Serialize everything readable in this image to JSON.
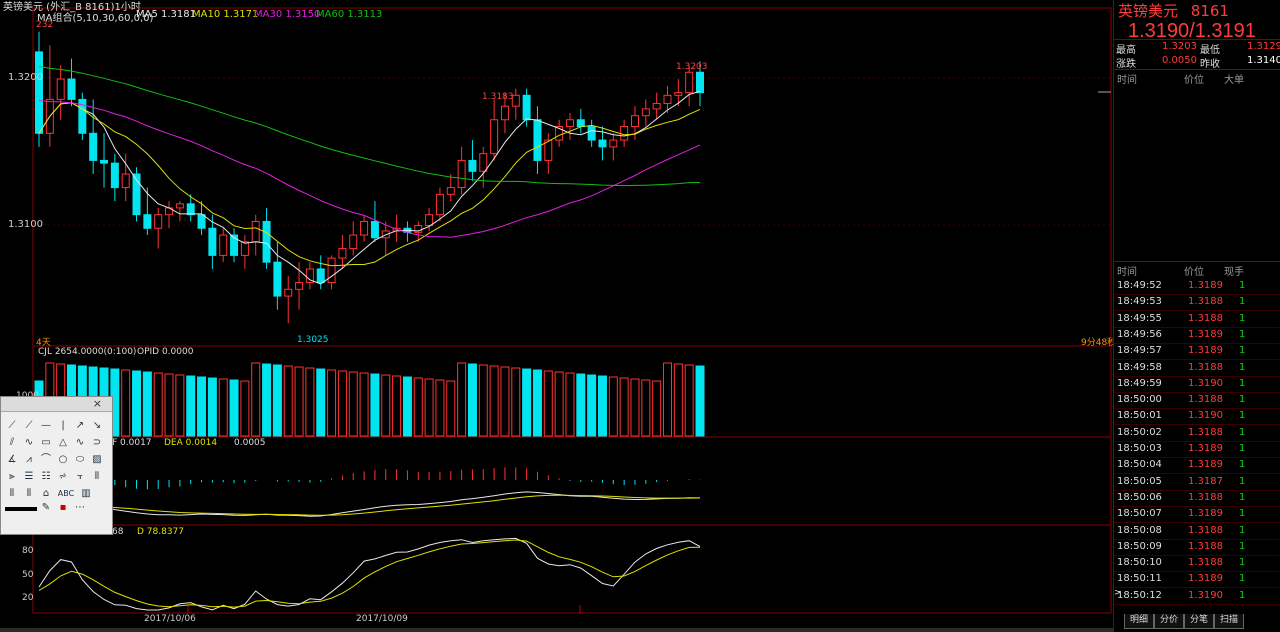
{
  "window": {
    "title": "英镑美元 (外汇_B 8161)1小时",
    "countdown": "9分48秒",
    "period_label": "4天"
  },
  "main_panel": {
    "ma_label": "MA组合(5,10,30,60,0,0)",
    "ma5": "MA5 1.3181",
    "ma10": "MA10 1.3171",
    "ma30": "MA30 1.3150",
    "ma60": "MA60 1.3113",
    "left_top_label": "232",
    "price_ticks": [
      "1.3200",
      "1.3100"
    ],
    "annotations": {
      "high_label": "1.3203",
      "mid_high_label": "1.3183",
      "low_label": "1.3025"
    }
  },
  "volume_panel": {
    "cjl": "CJL  2654.0000(0:100)",
    "opid": "OPID  0.0000",
    "tick": "1000"
  },
  "macd_panel": {
    "dif": "F  0.0017",
    "dea": "DEA  0.0014",
    "macd": "0.0005"
  },
  "kd_panel": {
    "k": "68",
    "d": "D  78.8377",
    "ticks": [
      "80",
      "50",
      "20"
    ]
  },
  "date_axis": [
    "2017/10/06",
    "2017/10/09"
  ],
  "colors": {
    "up": "#ff3232",
    "down": "#00e5f0",
    "ma5": "#e8e8e8",
    "ma10": "#e0e000",
    "ma30": "#e020e0",
    "ma60": "#10c010",
    "grid": "#8a0000"
  },
  "chart_data": {
    "type": "candlestick",
    "ohlc": [
      [
        1.321,
        1.3225,
        1.314,
        1.315
      ],
      [
        1.315,
        1.3215,
        1.314,
        1.3175
      ],
      [
        1.3175,
        1.32,
        1.316,
        1.319
      ],
      [
        1.319,
        1.3205,
        1.317,
        1.3175
      ],
      [
        1.3175,
        1.318,
        1.3145,
        1.315
      ],
      [
        1.315,
        1.3175,
        1.312,
        1.313
      ],
      [
        1.313,
        1.315,
        1.311,
        1.3128
      ],
      [
        1.3128,
        1.3135,
        1.31,
        1.311
      ],
      [
        1.311,
        1.3135,
        1.31,
        1.312
      ],
      [
        1.312,
        1.3125,
        1.3085,
        1.309
      ],
      [
        1.309,
        1.311,
        1.3075,
        1.308
      ],
      [
        1.308,
        1.3095,
        1.3065,
        1.309
      ],
      [
        1.309,
        1.31,
        1.308,
        1.3095
      ],
      [
        1.3095,
        1.31,
        1.3085,
        1.3098
      ],
      [
        1.3098,
        1.3105,
        1.3085,
        1.309
      ],
      [
        1.309,
        1.31,
        1.3075,
        1.308
      ],
      [
        1.308,
        1.309,
        1.305,
        1.306
      ],
      [
        1.306,
        1.308,
        1.3055,
        1.3075
      ],
      [
        1.3075,
        1.308,
        1.3055,
        1.306
      ],
      [
        1.306,
        1.3075,
        1.305,
        1.307
      ],
      [
        1.307,
        1.309,
        1.306,
        1.3085
      ],
      [
        1.3085,
        1.3095,
        1.305,
        1.3055
      ],
      [
        1.3055,
        1.307,
        1.302,
        1.303
      ],
      [
        1.303,
        1.3045,
        1.301,
        1.3035
      ],
      [
        1.3035,
        1.3055,
        1.302,
        1.304
      ],
      [
        1.304,
        1.3055,
        1.3035,
        1.305
      ],
      [
        1.305,
        1.306,
        1.3035,
        1.304
      ],
      [
        1.304,
        1.306,
        1.3035,
        1.3058
      ],
      [
        1.3058,
        1.3075,
        1.305,
        1.3065
      ],
      [
        1.3065,
        1.3085,
        1.306,
        1.3075
      ],
      [
        1.3075,
        1.309,
        1.307,
        1.3085
      ],
      [
        1.3085,
        1.31,
        1.307,
        1.3073
      ],
      [
        1.3073,
        1.3085,
        1.306,
        1.3078
      ],
      [
        1.3078,
        1.309,
        1.307,
        1.308
      ],
      [
        1.308,
        1.3085,
        1.307,
        1.3077
      ],
      [
        1.3077,
        1.3085,
        1.307,
        1.3082
      ],
      [
        1.3082,
        1.3095,
        1.3078,
        1.309
      ],
      [
        1.309,
        1.311,
        1.3085,
        1.3105
      ],
      [
        1.3105,
        1.312,
        1.31,
        1.311
      ],
      [
        1.311,
        1.314,
        1.3105,
        1.313
      ],
      [
        1.313,
        1.3145,
        1.3115,
        1.3122
      ],
      [
        1.3122,
        1.314,
        1.311,
        1.3135
      ],
      [
        1.3135,
        1.3175,
        1.313,
        1.316
      ],
      [
        1.316,
        1.318,
        1.315,
        1.317
      ],
      [
        1.317,
        1.3183,
        1.316,
        1.3178
      ],
      [
        1.3178,
        1.3183,
        1.3155,
        1.316
      ],
      [
        1.316,
        1.317,
        1.312,
        1.313
      ],
      [
        1.313,
        1.315,
        1.312,
        1.3145
      ],
      [
        1.3145,
        1.316,
        1.314,
        1.3155
      ],
      [
        1.3155,
        1.3165,
        1.3145,
        1.316
      ],
      [
        1.316,
        1.3168,
        1.315,
        1.3155
      ],
      [
        1.3155,
        1.316,
        1.314,
        1.3145
      ],
      [
        1.3145,
        1.3155,
        1.313,
        1.314
      ],
      [
        1.314,
        1.315,
        1.313,
        1.3145
      ],
      [
        1.3145,
        1.316,
        1.314,
        1.3155
      ],
      [
        1.3155,
        1.317,
        1.3145,
        1.3163
      ],
      [
        1.3163,
        1.3175,
        1.3155,
        1.3168
      ],
      [
        1.3168,
        1.318,
        1.316,
        1.3172
      ],
      [
        1.3172,
        1.3185,
        1.3165,
        1.3178
      ],
      [
        1.3178,
        1.319,
        1.317,
        1.318
      ],
      [
        1.318,
        1.32,
        1.317,
        1.3195
      ],
      [
        1.3195,
        1.3203,
        1.317,
        1.318
      ]
    ]
  },
  "quote": {
    "name": "英镑美元",
    "code": "8161",
    "bid_ask": "1.3190/1.3191",
    "high_label": "最高",
    "high": "1.3203",
    "low_label": "最低",
    "low": "1.3129",
    "change_label": "涨跌",
    "change": "0.0050",
    "prev_close_label": "昨收",
    "prev_close": "1.3140"
  },
  "orders_header": {
    "time": "时间",
    "price": "价位",
    "big": "大单"
  },
  "ticks_header": {
    "time": "时间",
    "price": "价位",
    "hand": "现手"
  },
  "ticks": [
    {
      "time": "18:49:52",
      "price": "1.3189",
      "vol": "1"
    },
    {
      "time": "18:49:53",
      "price": "1.3188",
      "vol": "1"
    },
    {
      "time": "18:49:55",
      "price": "1.3188",
      "vol": "1"
    },
    {
      "time": "18:49:56",
      "price": "1.3189",
      "vol": "1"
    },
    {
      "time": "18:49:57",
      "price": "1.3189",
      "vol": "1"
    },
    {
      "time": "18:49:58",
      "price": "1.3188",
      "vol": "1"
    },
    {
      "time": "18:49:59",
      "price": "1.3190",
      "vol": "1"
    },
    {
      "time": "18:50:00",
      "price": "1.3188",
      "vol": "1"
    },
    {
      "time": "18:50:01",
      "price": "1.3190",
      "vol": "1"
    },
    {
      "time": "18:50:02",
      "price": "1.3188",
      "vol": "1"
    },
    {
      "time": "18:50:03",
      "price": "1.3189",
      "vol": "1"
    },
    {
      "time": "18:50:04",
      "price": "1.3189",
      "vol": "1"
    },
    {
      "time": "18:50:05",
      "price": "1.3187",
      "vol": "1"
    },
    {
      "time": "18:50:06",
      "price": "1.3188",
      "vol": "1"
    },
    {
      "time": "18:50:07",
      "price": "1.3189",
      "vol": "1"
    },
    {
      "time": "18:50:08",
      "price": "1.3188",
      "vol": "1"
    },
    {
      "time": "18:50:09",
      "price": "1.3188",
      "vol": "1"
    },
    {
      "time": "18:50:10",
      "price": "1.3188",
      "vol": "1"
    },
    {
      "time": "18:50:11",
      "price": "1.3189",
      "vol": "1"
    },
    {
      "time": "18:50:12",
      "price": "1.3190",
      "vol": "1"
    }
  ],
  "bottom_tabs": [
    "明细",
    "分价",
    "分笔",
    "扫描"
  ],
  "toolbox": {
    "close": "×",
    "abc": "ABC"
  }
}
